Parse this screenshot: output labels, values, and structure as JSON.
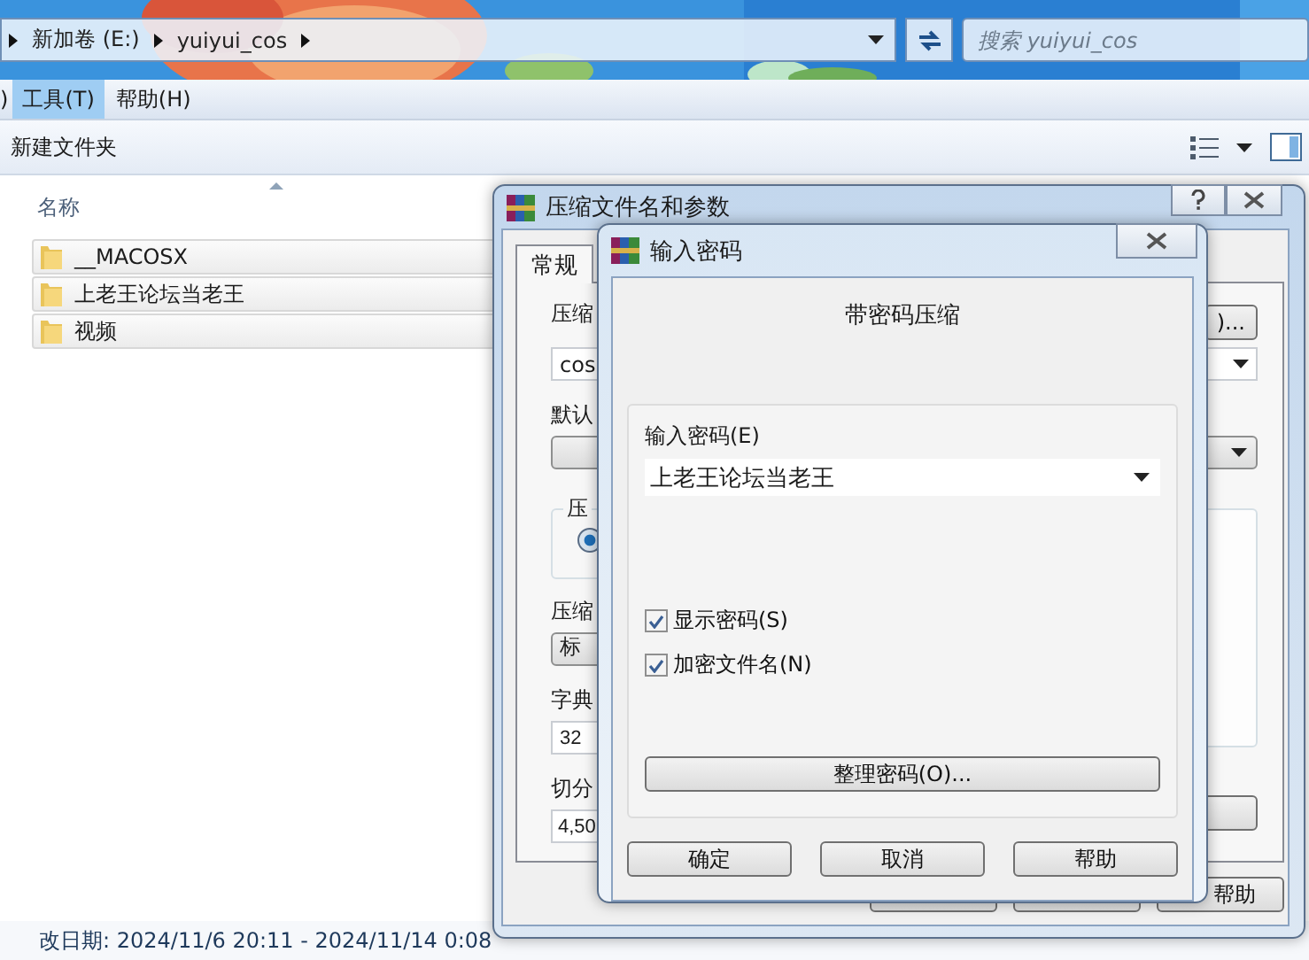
{
  "explorer": {
    "breadcrumb": [
      "新加卷 (E:)",
      "yuiyui_cos"
    ],
    "search": {
      "placeholder": "搜索 yuiyui_cos"
    },
    "menu": [
      {
        "label": ")",
        "selected": false
      },
      {
        "label": "工具(T)",
        "selected": true
      },
      {
        "label": "帮助(H)",
        "selected": false
      }
    ],
    "toolbar": {
      "new_folder": "新建文件夹"
    },
    "column_header": "名称",
    "files": [
      {
        "name": "__MACOSX"
      },
      {
        "name": "上老王论坛当老王"
      },
      {
        "name": "视频"
      }
    ],
    "status": "改日期: 2024/11/6 20:11 - 2024/11/14 0:08"
  },
  "archive_dialog": {
    "title": "压缩文件名和参数",
    "tabs": [
      {
        "label": "常规",
        "selected": true
      }
    ],
    "archive_name_label": "压缩",
    "archive_name_value": "cos",
    "browse_button": ")...",
    "profile_label": "默认",
    "format_label": "压",
    "format_radio": {
      "selected": true
    },
    "method_label": "压缩",
    "method_value": "标",
    "dictionary_label": "字典",
    "dictionary_value": "32",
    "split_label": "切分",
    "split_value": "4,50",
    "buttons": [
      "帮助"
    ]
  },
  "password_dialog": {
    "title": "输入密码",
    "heading": "带密码压缩",
    "password_label": "输入密码(E)",
    "password_value": "上老王论坛当老王",
    "options": [
      {
        "label": "显示密码(S)",
        "checked": true
      },
      {
        "label": "加密文件名(N)",
        "checked": true
      }
    ],
    "organize_button": "整理密码(O)...",
    "buttons": [
      "确定",
      "取消",
      "帮助"
    ]
  }
}
